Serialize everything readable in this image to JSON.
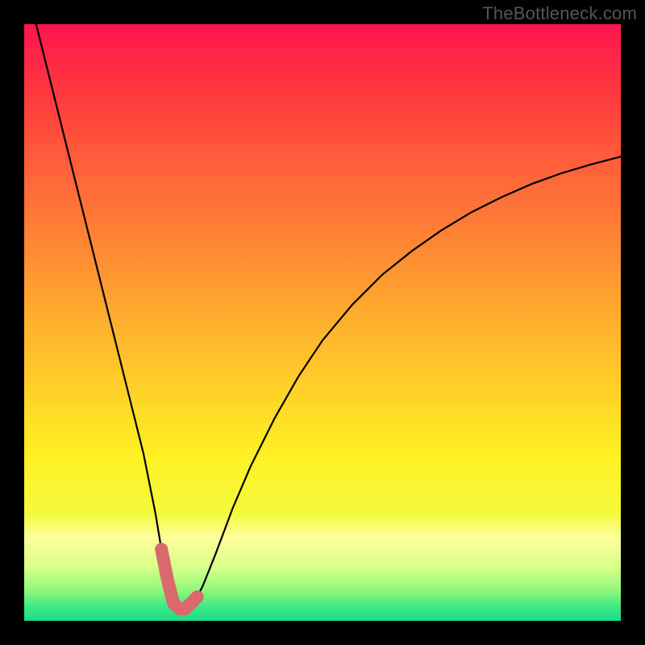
{
  "watermark": "TheBottleneck.com",
  "chart_data": {
    "type": "line",
    "title": "",
    "xlabel": "",
    "ylabel": "",
    "xlim": [
      0,
      100
    ],
    "ylim": [
      0,
      100
    ],
    "x": [
      2,
      5,
      8,
      11,
      14,
      17,
      20,
      22,
      23,
      24,
      25,
      26,
      27,
      28,
      29,
      30,
      32,
      35,
      38,
      42,
      46,
      50,
      55,
      60,
      65,
      70,
      75,
      80,
      85,
      90,
      95,
      100
    ],
    "values": [
      100,
      88,
      76,
      64,
      52,
      40,
      28,
      18,
      12,
      7,
      3,
      2,
      2,
      3,
      4,
      6,
      11,
      19,
      26,
      34,
      41,
      47,
      53,
      58,
      62,
      65.5,
      68.5,
      71,
      73.2,
      75,
      76.5,
      77.8
    ],
    "highlight_band": {
      "x_start": 23,
      "x_end": 29,
      "color": "#d9696b",
      "stroke_width": 16
    },
    "gradient_stops": [
      {
        "offset": 0.0,
        "color": "#ff1450"
      },
      {
        "offset": 0.12,
        "color": "#ff3b3f"
      },
      {
        "offset": 0.25,
        "color": "#ff643a"
      },
      {
        "offset": 0.38,
        "color": "#ff8a34"
      },
      {
        "offset": 0.5,
        "color": "#ffb02e"
      },
      {
        "offset": 0.62,
        "color": "#ffd328"
      },
      {
        "offset": 0.72,
        "color": "#fff024"
      },
      {
        "offset": 0.82,
        "color": "#f4fa3c"
      },
      {
        "offset": 0.86,
        "color": "#fdff9a"
      },
      {
        "offset": 0.91,
        "color": "#d8ff8a"
      },
      {
        "offset": 0.95,
        "color": "#8ef77a"
      },
      {
        "offset": 0.975,
        "color": "#41e983"
      },
      {
        "offset": 1.0,
        "color": "#18df87"
      }
    ]
  }
}
